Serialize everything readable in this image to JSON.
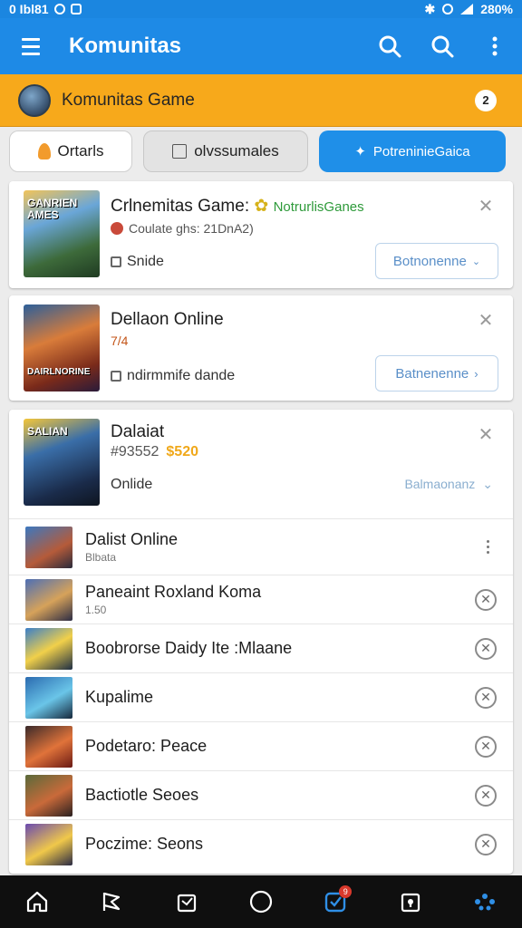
{
  "status_bar": {
    "left_text": "0 Ibl81",
    "battery": "280%"
  },
  "app_bar": {
    "title": "Komunitas"
  },
  "banner": {
    "title": "Komunitas Game",
    "badge": "2"
  },
  "chips": [
    {
      "label": "Ortarls"
    },
    {
      "label": "olvssumales"
    },
    {
      "label": "PotreninieGaica"
    }
  ],
  "featured": [
    {
      "thumb_text": "GANRIEN AMES",
      "title": "Crlnemitas Game:",
      "title_accent": "NotrurlisGanes",
      "subtitle": "Coulate ghs: 21DnA2)",
      "meta": "Snide",
      "button": "Botnonenne"
    },
    {
      "thumb_text": "DAIRLNORINE",
      "title": "Dellaon Online",
      "subtitle": "7/4",
      "meta": "ndirmmife dande",
      "button": "Batnenenne"
    },
    {
      "thumb_text": "SALIAN",
      "title": "Dalaiat",
      "subtitle": "#93552",
      "price": "$520",
      "meta": "Onlide",
      "button": "Balmaonanz"
    }
  ],
  "list": [
    {
      "title": "Dalist Online",
      "sub": "Blbata"
    },
    {
      "title": "Paneaint Roxland Koma",
      "sub": "1.50"
    },
    {
      "title": "Boobrorse Daidy Ite :Mlaane",
      "sub": ""
    },
    {
      "title": "Kupalime",
      "sub": ""
    },
    {
      "title": "Podetaro: Peace",
      "sub": ""
    },
    {
      "title": "Bactiotle Seoes",
      "sub": ""
    },
    {
      "title": "Poczime: Seons",
      "sub": ""
    }
  ],
  "bottom_nav": {
    "badge": "9"
  },
  "colors": {
    "primary": "#1e8ae6",
    "banner": "#f7a91b",
    "nav": "#0f0f0f",
    "accent_price": "#f0a81a"
  }
}
